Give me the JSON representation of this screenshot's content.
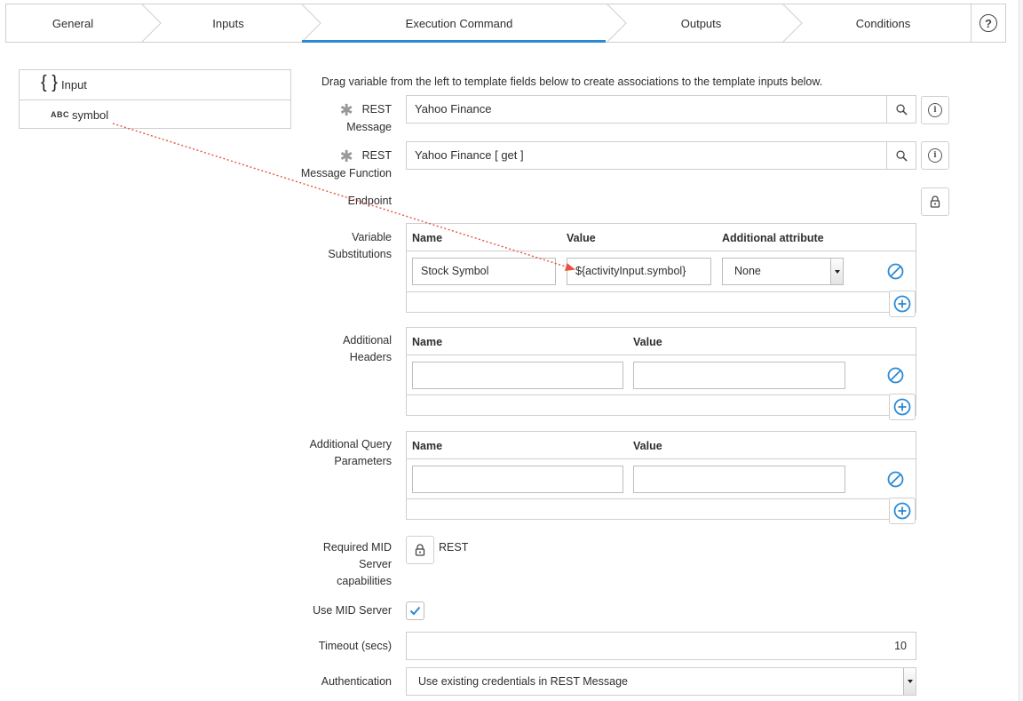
{
  "wizard": {
    "steps": [
      {
        "label": "General"
      },
      {
        "label": "Inputs"
      },
      {
        "label": "Execution Command"
      },
      {
        "label": "Outputs"
      },
      {
        "label": "Conditions"
      }
    ],
    "active_step": "Execution Command",
    "help_glyph": "?"
  },
  "input_tree": {
    "root_label": "Input",
    "root_glyph": "{ }",
    "child_type": "ABC",
    "child_label": "symbol"
  },
  "form": {
    "hint": "Drag variable from the left to template fields below to create associations to the template inputs below.",
    "rest_message": {
      "label_line1": "REST",
      "label_line2": "Message",
      "value": "Yahoo Finance"
    },
    "rest_function": {
      "label_line1": "REST",
      "label_line2": "Message Function",
      "value": "Yahoo Finance [ get ]"
    },
    "endpoint": {
      "label": "Endpoint"
    },
    "variable_substitutions": {
      "label_line1": "Variable",
      "label_line2": "Substitutions",
      "col_name": "Name",
      "col_value": "Value",
      "col_attr": "Additional attribute",
      "row": {
        "name": "Stock Symbol",
        "value": "${activityInput.symbol}",
        "attribute": "None"
      }
    },
    "additional_headers": {
      "label_line1": "Additional",
      "label_line2": "Headers",
      "col_name": "Name",
      "col_value": "Value",
      "row": {
        "name": "",
        "value": ""
      }
    },
    "query_parameters": {
      "label_line1": "Additional Query",
      "label_line2": "Parameters",
      "col_name": "Name",
      "col_value": "Value",
      "row": {
        "name": "",
        "value": ""
      }
    },
    "mid_capabilities": {
      "label_line1": "Required MID",
      "label_line2": "Server",
      "label_line3": "capabilities",
      "value": "REST"
    },
    "use_mid": {
      "label": "Use MID Server",
      "checked": true
    },
    "timeout": {
      "label": "Timeout (secs)",
      "value": "10"
    },
    "authentication": {
      "label": "Authentication",
      "value": "Use existing credentials in REST Message"
    }
  },
  "colors": {
    "accent": "#2b8ad6",
    "drag_arrow": "#e8533f",
    "border": "#cfcfcf"
  }
}
